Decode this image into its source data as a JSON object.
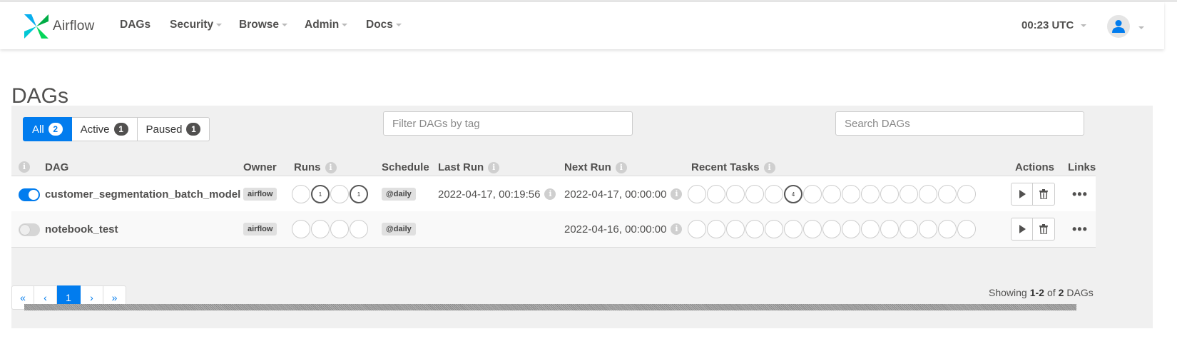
{
  "navbar": {
    "brand": "Airflow",
    "items": [
      {
        "label": "DAGs",
        "dropdown": false
      },
      {
        "label": "Security",
        "dropdown": true
      },
      {
        "label": "Browse",
        "dropdown": true
      },
      {
        "label": "Admin",
        "dropdown": true
      },
      {
        "label": "Docs",
        "dropdown": true
      }
    ],
    "clock": "00:23 UTC"
  },
  "page_title": "DAGs",
  "filters": {
    "all": {
      "label": "All",
      "count": "2"
    },
    "active": {
      "label": "Active",
      "count": "1"
    },
    "paused": {
      "label": "Paused",
      "count": "1"
    },
    "tag_placeholder": "Filter DAGs by tag",
    "search_placeholder": "Search DAGs"
  },
  "table": {
    "headers": {
      "dag": "DAG",
      "owner": "Owner",
      "runs": "Runs",
      "schedule": "Schedule",
      "last_run": "Last Run",
      "next_run": "Next Run",
      "recent_tasks": "Recent Tasks",
      "actions": "Actions",
      "links": "Links"
    },
    "info_glyph": "i",
    "rows": [
      {
        "enabled": true,
        "name": "customer_segmentation_batch_model",
        "owner": "airflow",
        "runs": [
          "",
          "1",
          "",
          "1"
        ],
        "schedule": "@daily",
        "last_run": "2022-04-17, 00:19:56",
        "next_run": "2022-04-17, 00:00:00",
        "recent_tasks": [
          "",
          "",
          "",
          "",
          "",
          "4",
          "",
          "",
          "",
          "",
          "",
          "",
          "",
          "",
          ""
        ],
        "links": "•••"
      },
      {
        "enabled": false,
        "name": "notebook_test",
        "owner": "airflow",
        "runs": [
          "",
          "",
          "",
          ""
        ],
        "schedule": "@daily",
        "last_run": "",
        "next_run": "2022-04-16, 00:00:00",
        "recent_tasks": [
          "",
          "",
          "",
          "",
          "",
          "",
          "",
          "",
          "",
          "",
          "",
          "",
          "",
          "",
          ""
        ],
        "links": "•••"
      }
    ]
  },
  "pagination": {
    "first": "«",
    "prev": "‹",
    "current": "1",
    "next": "›",
    "last": "»"
  },
  "showing": {
    "prefix": "Showing",
    "range": "1-2",
    "of": "of",
    "total": "2",
    "suffix": "DAGs"
  },
  "colors": {
    "accent": "#017cee",
    "text": "#51504f"
  }
}
